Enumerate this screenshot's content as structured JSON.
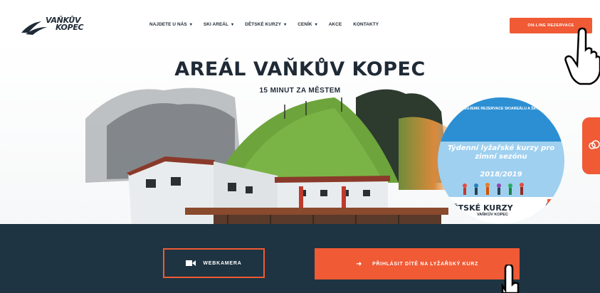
{
  "logo": {
    "line1": "VAŇKŮV",
    "line2": "KOPEC"
  },
  "nav": {
    "items": [
      {
        "label": "NAJDETE U NÁS",
        "dropdown": true
      },
      {
        "label": "SKI AREÁL",
        "dropdown": true
      },
      {
        "label": "DĚTSKÉ KURZY",
        "dropdown": true
      },
      {
        "label": "CENÍK",
        "dropdown": true
      },
      {
        "label": "AKCE",
        "dropdown": false
      },
      {
        "label": "KONTAKTY",
        "dropdown": false
      }
    ],
    "reserve_label": "ON-LINE REZERVACE"
  },
  "hero": {
    "title": "AREÁL VAŇKŮV KOPEC",
    "subtitle": "15 MINUT ZA MĚSTEM"
  },
  "promo": {
    "small_text": "ZAHAJUJEME REZERVACE SKIAREÁLU A ŠKOL NA",
    "main_text": "Týdenní lyžařské kurzy pro zimní sezónu",
    "year": "2018/2019",
    "brand": "DĚTSKÉ KURZY",
    "brand_sub": "VAŇKŮV KOPEC"
  },
  "buttons": {
    "webcam_label": "WEBKAMERA",
    "course_label": "PŘIHLÁSIT DÍTĚ NA LYŽAŘSKÝ KURZ"
  },
  "icons": {
    "caret": "▾",
    "arrow": "➜"
  },
  "colors": {
    "accent": "#f05a35",
    "dark": "#1e3442",
    "text": "#1f2a36"
  }
}
